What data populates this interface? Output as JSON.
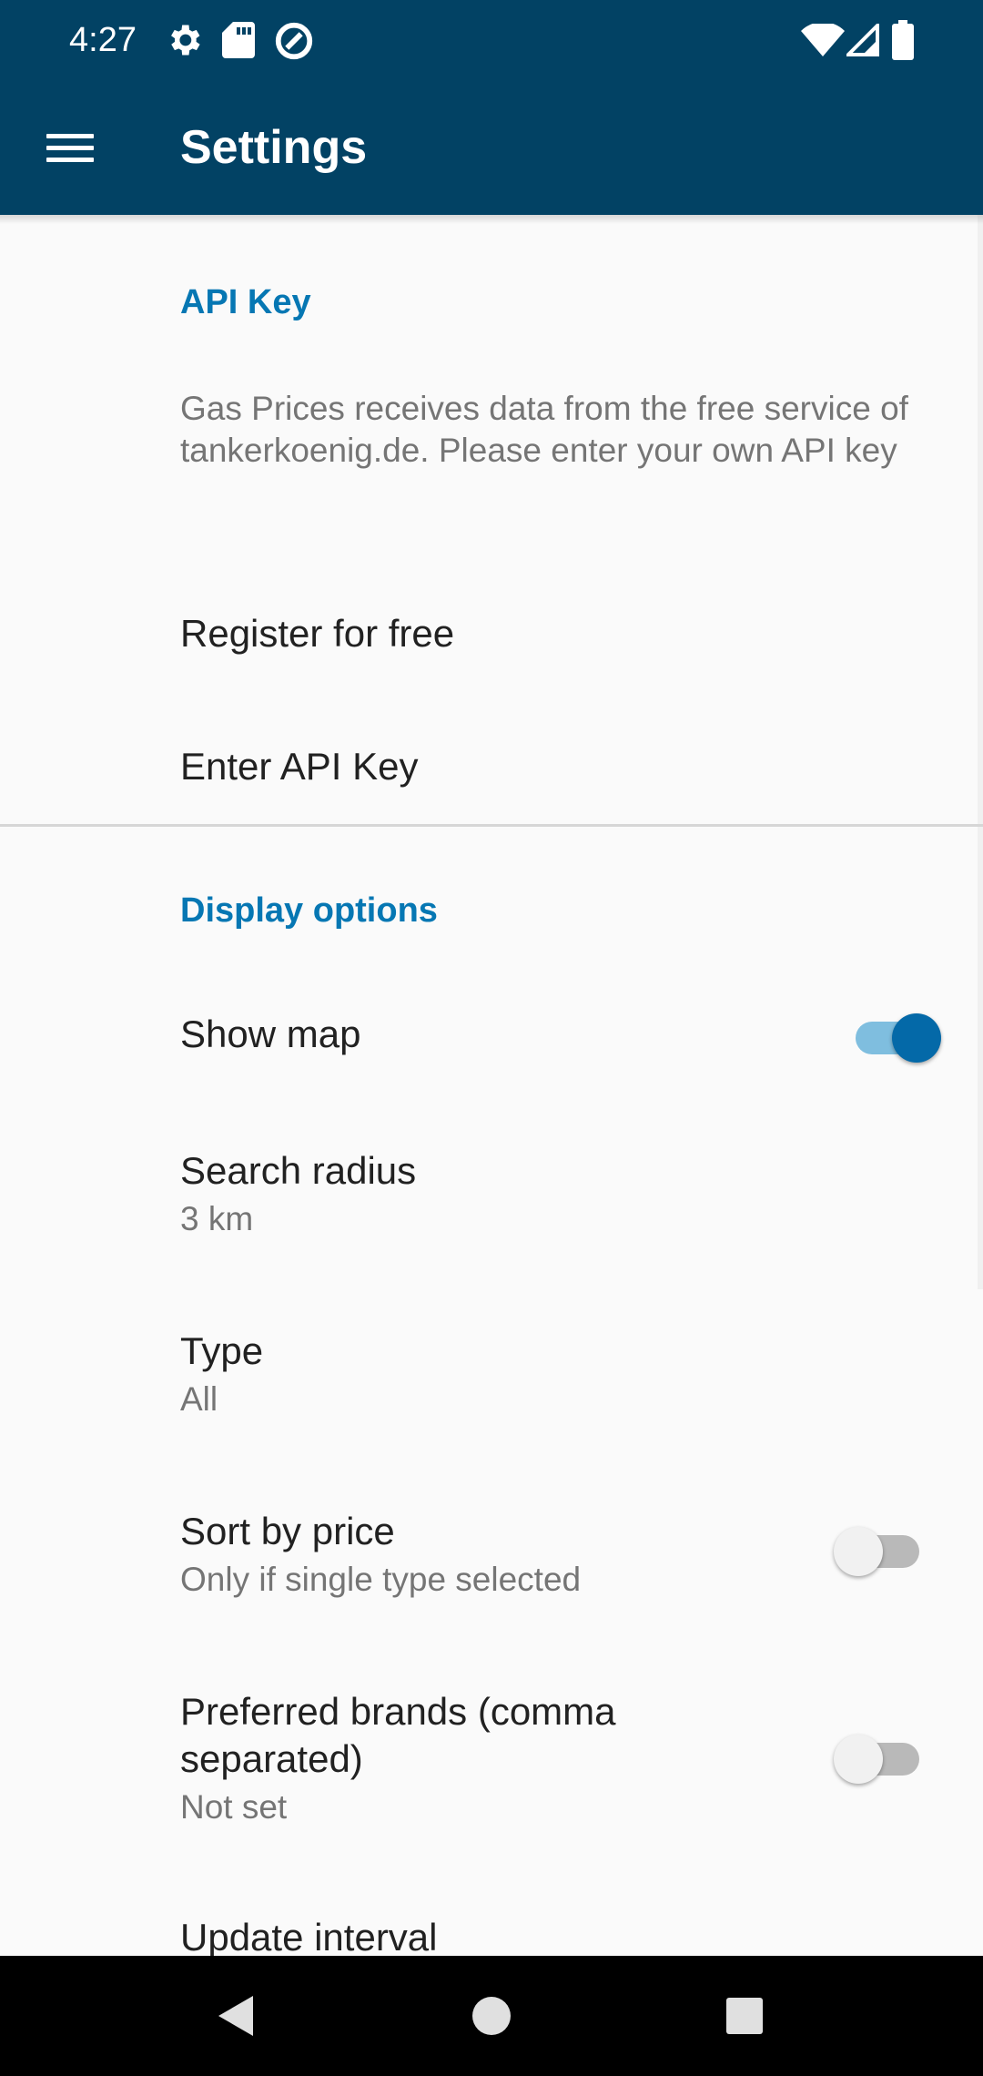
{
  "status_bar": {
    "time": "4:27",
    "left_icons": [
      "gear-icon",
      "sd-card-icon",
      "data-saver-icon"
    ],
    "right_icons": [
      "wifi-icon",
      "signal-icon",
      "battery-icon"
    ]
  },
  "app_bar": {
    "title": "Settings",
    "menu_icon": "hamburger-menu-icon",
    "color": "#024264"
  },
  "sections": {
    "api_key": {
      "header": "API Key",
      "description": "Gas Prices receives data from the free service of tankerkoenig.de. Please enter your own API key",
      "register": "Register for free",
      "enter_key": "Enter API Key"
    },
    "display": {
      "header": "Display options",
      "show_map": {
        "title": "Show map",
        "enabled": true
      },
      "search_radius": {
        "title": "Search radius",
        "value": "3 km"
      },
      "type": {
        "title": "Type",
        "value": "All"
      },
      "sort_by_price": {
        "title": "Sort by price",
        "summary": "Only if single type selected",
        "enabled": false
      },
      "preferred_brands": {
        "title_line1": "Preferred brands (comma",
        "title_line2": "separated)",
        "value": "Not set",
        "enabled": false
      },
      "update_interval": {
        "title": "Update interval"
      }
    }
  },
  "nav_bar": {
    "buttons": [
      "back-icon",
      "home-icon",
      "recents-icon"
    ]
  },
  "colors": {
    "accent": "#0677b3",
    "switch_on_thumb": "#0469a8",
    "switch_on_track": "#7fbedf",
    "background": "#fafafa"
  }
}
